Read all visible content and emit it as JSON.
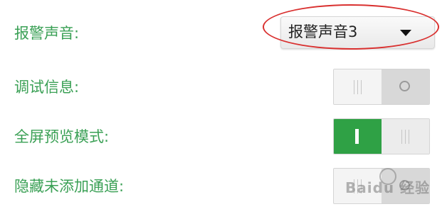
{
  "settings": {
    "alarm_sound": {
      "label": "报警声音:",
      "selected": "报警声音3"
    },
    "debug_info": {
      "label": "调试信息:",
      "enabled": false
    },
    "fullscreen_preview": {
      "label": "全屏预览模式:",
      "enabled": true
    },
    "hide_unadded_channels": {
      "label": "隐藏未添加通道:",
      "enabled": false
    }
  },
  "annotation": {
    "highlight_color": "#d9302f"
  },
  "watermark": {
    "text": "Baidu 经验"
  },
  "colors": {
    "label_green": "#3aa055",
    "toggle_on": "#2fa145"
  }
}
